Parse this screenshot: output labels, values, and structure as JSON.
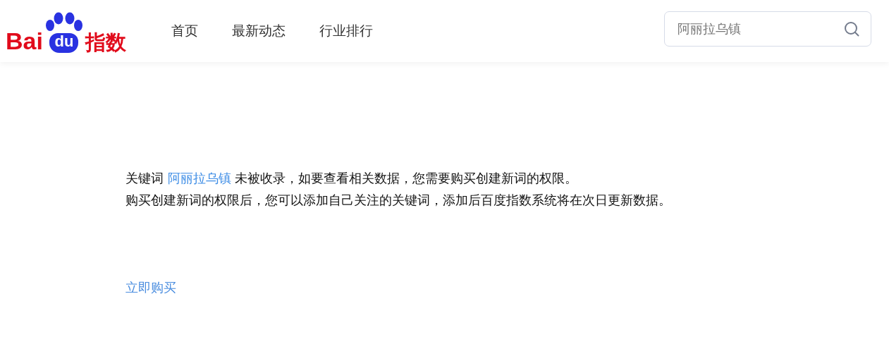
{
  "logo": {
    "part_1": "Bai",
    "part_2": "du",
    "part_3": "指数"
  },
  "nav": [
    {
      "label": "首页"
    },
    {
      "label": "最新动态"
    },
    {
      "label": "行业排行"
    }
  ],
  "search": {
    "value": "阿丽拉乌镇"
  },
  "notice": {
    "prefix": "关键词",
    "keyword": "阿丽拉乌镇",
    "suffix": "未被收录，如要查看相关数据，您需要购买创建新词的权限。",
    "line_2": "购买创建新词的权限后，您可以添加自己关注的关键词，添加后百度指数系统将在次日更新数据。"
  },
  "buy_link": "立即购买"
}
